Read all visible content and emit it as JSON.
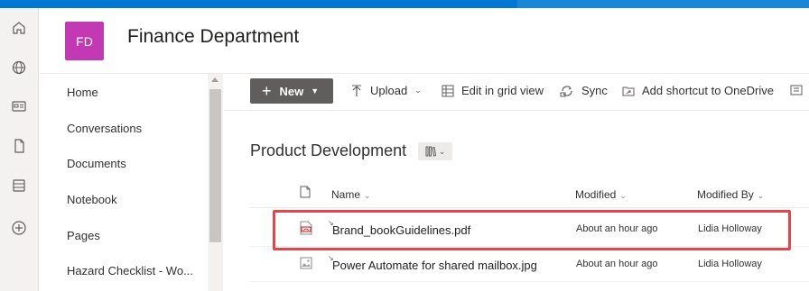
{
  "site": {
    "logo_initials": "FD",
    "logo_color": "#c239b3",
    "title": "Finance Department"
  },
  "app_rail": {
    "icons": [
      "home-icon",
      "globe-icon",
      "news-icon",
      "file-icon",
      "list-icon",
      "add-icon"
    ]
  },
  "left_nav": {
    "items": [
      {
        "label": "Home"
      },
      {
        "label": "Conversations"
      },
      {
        "label": "Documents"
      },
      {
        "label": "Notebook"
      },
      {
        "label": "Pages"
      },
      {
        "label": "Hazard Checklist - Wo..."
      }
    ]
  },
  "command_bar": {
    "new_label": "New",
    "upload_label": "Upload",
    "edit_grid_label": "Edit in grid view",
    "sync_label": "Sync",
    "add_shortcut_label": "Add shortcut to OneDrive"
  },
  "library": {
    "title": "Product Development",
    "columns": {
      "name": "Name",
      "modified": "Modified",
      "modified_by": "Modified By"
    },
    "rows": [
      {
        "name": "Brand_bookGuidelines.pdf",
        "modified": "About an hour ago",
        "modified_by": "Lidia Holloway",
        "icon": "pdf-file-icon",
        "highlighted": true
      },
      {
        "name": "Power Automate for shared mailbox.jpg",
        "modified": "About an hour ago",
        "modified_by": "Lidia Holloway",
        "icon": "image-file-icon",
        "highlighted": false
      }
    ]
  },
  "colors": {
    "accent": "#0078d4",
    "highlight_border": "#e0474c",
    "new_button": "#605e5c"
  }
}
